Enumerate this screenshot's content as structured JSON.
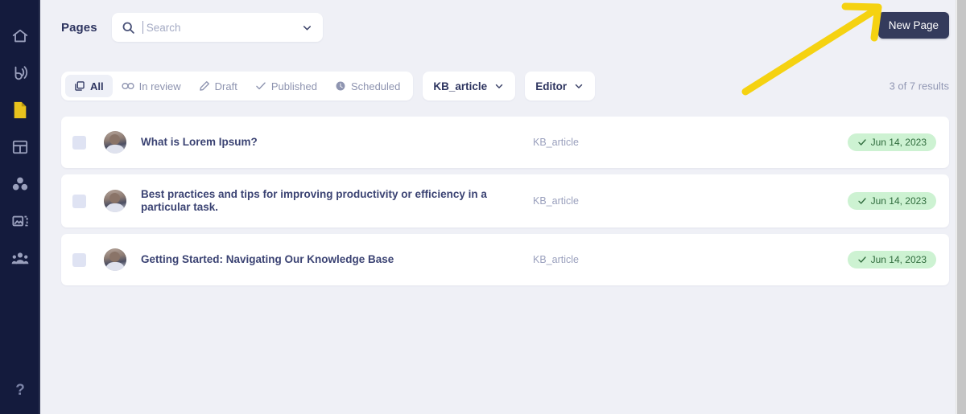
{
  "sidebar": {
    "items": [
      {
        "icon": "home-icon",
        "name": "home"
      },
      {
        "icon": "broadcast-icon",
        "name": "broadcast"
      },
      {
        "icon": "page-icon",
        "name": "pages",
        "active": true
      },
      {
        "icon": "table-icon",
        "name": "tables"
      },
      {
        "icon": "blocks-icon",
        "name": "blocks"
      },
      {
        "icon": "media-icon",
        "name": "media"
      },
      {
        "icon": "team-icon",
        "name": "team"
      }
    ],
    "help_label": "?"
  },
  "header": {
    "title": "Pages",
    "new_page_label": "New Page"
  },
  "search": {
    "placeholder": "Search",
    "value": ""
  },
  "toolbar": {
    "tabs": [
      {
        "label": "All",
        "icon": "copy-icon",
        "active": true
      },
      {
        "label": "In review",
        "icon": "glasses-icon",
        "active": false
      },
      {
        "label": "Draft",
        "icon": "pencil-icon",
        "active": false
      },
      {
        "label": "Published",
        "icon": "check-icon",
        "active": false
      },
      {
        "label": "Scheduled",
        "icon": "clock-icon",
        "active": false
      }
    ],
    "dropdowns": [
      {
        "label": "KB_article"
      },
      {
        "label": "Editor"
      }
    ],
    "results_count": "3 of 7 results"
  },
  "list": {
    "rows": [
      {
        "title": "What is Lorem Ipsum?",
        "category": "KB_article",
        "date": "Jun 14, 2023"
      },
      {
        "title": "Best practices and tips for improving productivity or efficiency in a particular task.",
        "category": "KB_article",
        "date": "Jun 14, 2023"
      },
      {
        "title": "Getting Started: Navigating Our Knowledge Base",
        "category": "KB_article",
        "date": "Jun 14, 2023"
      }
    ]
  },
  "colors": {
    "sidebar_bg": "#141b3d",
    "page_bg": "#eff0f6",
    "accent_active": "#e8c21d",
    "button_dark": "#343b5c",
    "badge_bg": "#cdf2d2",
    "badge_text": "#2f6b3c",
    "annotation_arrow": "#f5d211"
  },
  "annotation": {
    "type": "arrow",
    "points_to": "new-page-button",
    "color": "#f5d211"
  }
}
